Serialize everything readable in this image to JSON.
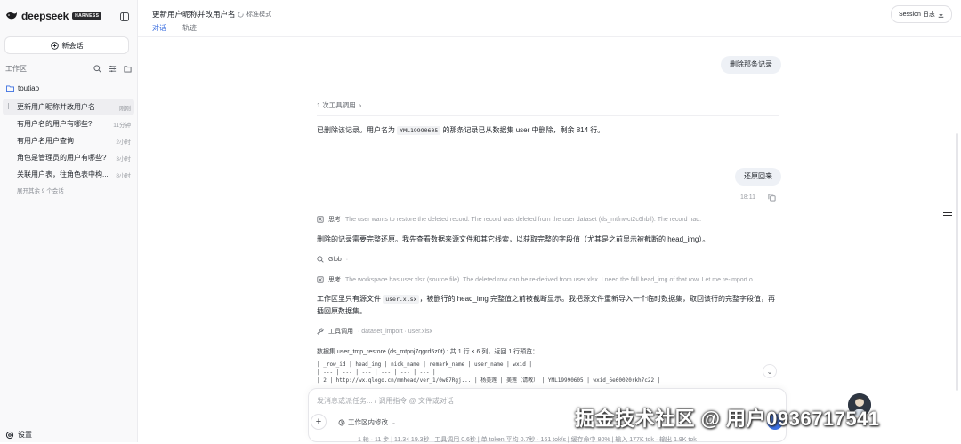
{
  "brand": {
    "name": "deepseek",
    "badge": "HARNESS"
  },
  "sidebar": {
    "new_chat": "新会话",
    "workspace_title": "工作区",
    "folder": "toutiao",
    "conversations": [
      {
        "title": "更新用户昵称并改用户名",
        "meta": "刚刚"
      },
      {
        "title": "有用户名的用户有哪些?",
        "meta": "11分钟"
      },
      {
        "title": "有用户名用户查询",
        "meta": "2小时"
      },
      {
        "title": "角色是管理员的用户有哪些?",
        "meta": "3小时"
      },
      {
        "title": "关联用户表，往角色表中构...",
        "meta": "8小时"
      }
    ],
    "more": "展开其余 9 个会话",
    "settings": "设置"
  },
  "header": {
    "title": "更新用户昵称并改用户名",
    "mode": "标准模式",
    "tabs": [
      "对话",
      "轨迹"
    ],
    "session_log": "Session 日志"
  },
  "chat": {
    "user_msg_1": "删除那条记录",
    "tool_calls_summary": "1 次工具调用",
    "reply_1": {
      "pre": "已删除该记录。用户名为 ",
      "code": "YML19990605",
      "post": " 的那条记录已从数据集 user 中删除，剩余 814 行。"
    },
    "user_msg_2": "还原回来",
    "user_msg_2_time": "18:11",
    "think_1": {
      "label": "思考",
      "text": "The user wants to restore the deleted record. The record was deleted from the user dataset (ds_mtfnwct2c6hbil). The record had:"
    },
    "para_1": "删除的记录需要完整还原。我先查看数据来源文件和其它线索，以获取完整的字段值（尤其是之前显示被截断的 head_img）。",
    "glob": {
      "label": "Glob",
      "dot": "·"
    },
    "think_2": {
      "label": "思考",
      "text": "The workspace has user.xlsx (source file). The deleted row can be re-derived from user.xlsx. I need the full head_img of that row. Let me re-import o..."
    },
    "para_2": {
      "pre": "工作区里只有源文件 ",
      "code": "user.xlsx",
      "post": "，被删行的 head_img 完整值之前被截断显示。我把源文件重新导入一个临时数据集，取回该行的完整字段值，再插回原数据集。"
    },
    "tool_call": {
      "label": "工具调用",
      "detail": "· dataset_import · user.xlsx"
    },
    "dataset_result": "数据集 user_tmp_restore (ds_mtpnj7qgrd5z0t) : 共 1 行 × 6 列，返回 1 行预览：",
    "table_header": "| _row_id | head_img | nick_name | remark_name | user_name | wxid |",
    "table_sep": "| --- | --- | --- | --- | --- | --- |",
    "table_row": "| 2 | http://wx.qlogo.cn/mmhead/ver_1/0w87Rgj... | 杨美莲 | 美莲（请教） | YML19990605 | wxid_6e60020rkh7c22 |"
  },
  "input": {
    "placeholder": "发消息或派任务... / 调用指令 @ 文件或对话",
    "scope": "工作区内修改",
    "status": "1 轮 · 11 步 | 11.34 19.3秒 | 工具调用 0.6秒 | 单 token 平均 0.7秒 · 161 tok/s | 缓存命中 80% | 输入 177K tok · 输出 1.9K tok"
  },
  "watermark": "掘金技术社区 @ 用户0936717541"
}
